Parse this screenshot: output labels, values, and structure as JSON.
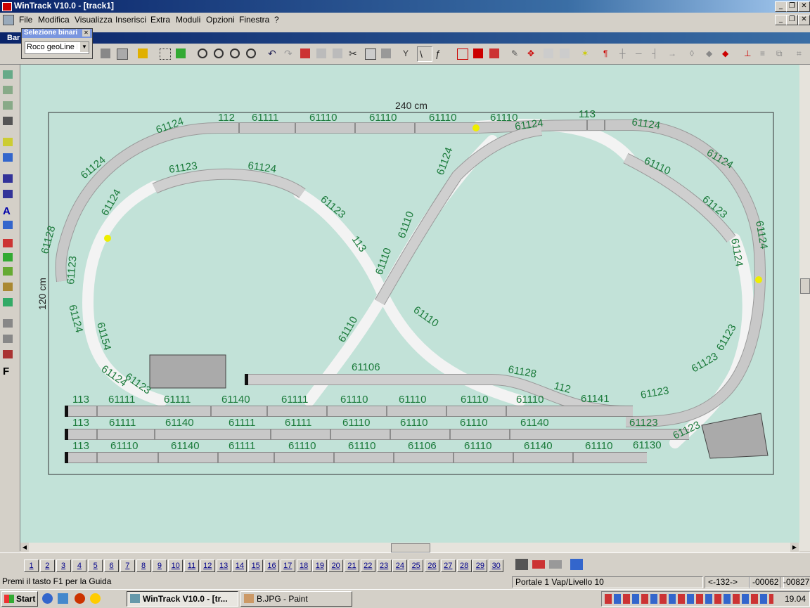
{
  "window": {
    "title": "WinTrack  V10.0 - [track1]"
  },
  "menu": [
    "File",
    "Modifica",
    "Visualizza",
    "Inserisci",
    "Extra",
    "Moduli",
    "Opzioni",
    "Finestra",
    "?"
  ],
  "panel": {
    "title": "Selezione binari",
    "toolbar_stub": "Bar",
    "dropdown_value": "Roco geoLine H"
  },
  "drawing": {
    "width_label": "240 cm",
    "height_label": "120 cm",
    "track_labels": [
      "61124",
      "112",
      "61111",
      "61110",
      "61110",
      "61110",
      "61110",
      "61124",
      "113",
      "61124",
      "61123",
      "61124",
      "61124",
      "61124",
      "61123",
      "61128",
      "113",
      "61110",
      "61110",
      "61124",
      "61110",
      "61123",
      "61124",
      "61123",
      "61124",
      "61124",
      "61124",
      "61154",
      "61110",
      "61110",
      "61106",
      "61128",
      "112",
      "61123",
      "61123",
      "61123",
      "61141",
      "61124",
      "61123",
      "113",
      "61111",
      "61111",
      "61140",
      "61111",
      "61110",
      "61110",
      "61110",
      "61110",
      "113",
      "61111",
      "61140",
      "61111",
      "61111",
      "61110",
      "61110",
      "61110",
      "61140",
      "61123",
      "113",
      "61110",
      "61140",
      "61111",
      "61110",
      "61110",
      "61106",
      "61110",
      "61140",
      "61110",
      "61130",
      "61123"
    ]
  },
  "pages": [
    "1",
    "2",
    "3",
    "4",
    "5",
    "6",
    "7",
    "8",
    "9",
    "10",
    "11",
    "12",
    "13",
    "14",
    "15",
    "16",
    "17",
    "18",
    "19",
    "20",
    "21",
    "22",
    "23",
    "24",
    "25",
    "26",
    "27",
    "28",
    "29",
    "30"
  ],
  "status": {
    "help": "Premi il tasto F1 per la Guida",
    "level": "Portale 1 Vap/Livello 10",
    "coord": "<-132->",
    "x": "-00062",
    "y": "-00827"
  },
  "taskbar": {
    "start": "Start",
    "task1": "WinTrack  V10.0 - [tr...",
    "task2": "B.JPG - Paint",
    "clock": "19.04"
  }
}
